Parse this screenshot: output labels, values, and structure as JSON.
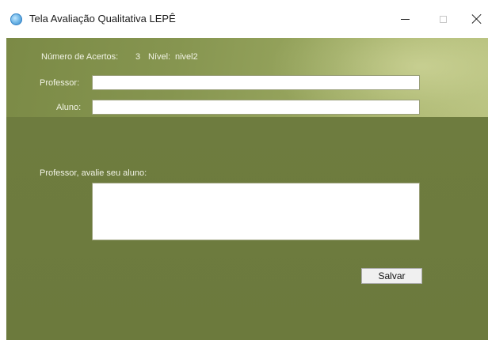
{
  "window": {
    "title": "Tela Avaliação Qualitativa LEPÊ",
    "icon": "app-globe-icon",
    "controls": {
      "minimize": "minimize-icon",
      "maximize": "maximize-icon",
      "close": "close-icon"
    }
  },
  "form": {
    "acertos_label": "Número de Acertos:",
    "acertos_value": "3",
    "nivel_label": "Nível:",
    "nivel_value": "nivel2",
    "professor_label": "Professor:",
    "professor_value": "",
    "aluno_label": "Aluno:",
    "aluno_value": "",
    "avaliacao_label": "Professor, avalie seu aluno:",
    "avaliacao_value": "",
    "save_label": "Salvar"
  },
  "colors": {
    "client_background": "#6f7d40",
    "header_highlight": "#b9c27f",
    "label_text": "#f2f4e6"
  }
}
